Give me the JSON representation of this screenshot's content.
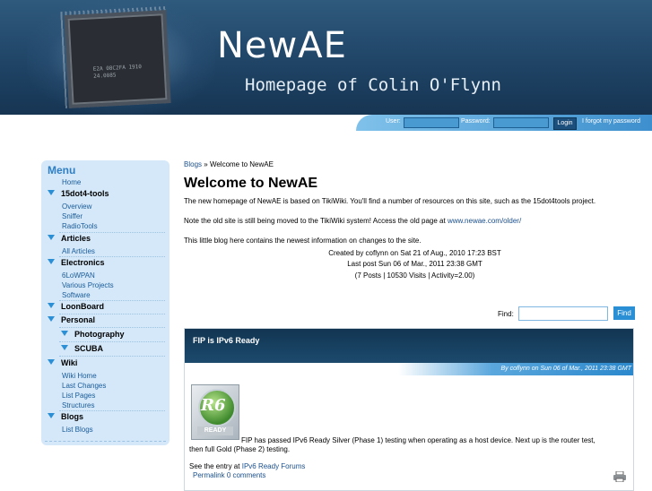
{
  "header": {
    "site_title": "NewAE",
    "site_subtitle": "Homepage of Colin O'Flynn",
    "chip_text": "E2A 08C2FA 1910 24.0085"
  },
  "login": {
    "user_label": "User:",
    "password_label": "Password:",
    "login_button": "Login",
    "forgot_link": "I forgot my password"
  },
  "sidebar": {
    "title": "Menu",
    "items": [
      {
        "label": "Home",
        "kind": "sub"
      },
      {
        "label": "15dot4-tools",
        "kind": "section"
      },
      {
        "label": "Overview",
        "kind": "sub"
      },
      {
        "label": "Sniffer",
        "kind": "sub"
      },
      {
        "label": "RadioTools",
        "kind": "sub"
      },
      {
        "label": "Articles",
        "kind": "section"
      },
      {
        "label": "All Articles",
        "kind": "sub"
      },
      {
        "label": "Electronics",
        "kind": "section"
      },
      {
        "label": "6LoWPAN",
        "kind": "sub"
      },
      {
        "label": "Various Projects",
        "kind": "sub"
      },
      {
        "label": "Software",
        "kind": "sub"
      },
      {
        "label": "LoonBoard",
        "kind": "section"
      },
      {
        "label": "Personal",
        "kind": "section"
      },
      {
        "label": "Photography",
        "kind": "section2"
      },
      {
        "label": "SCUBA",
        "kind": "section2"
      },
      {
        "label": "Wiki",
        "kind": "section"
      },
      {
        "label": "Wiki Home",
        "kind": "sub"
      },
      {
        "label": "Last Changes",
        "kind": "sub"
      },
      {
        "label": "List Pages",
        "kind": "sub"
      },
      {
        "label": "Structures",
        "kind": "sub"
      },
      {
        "label": "Blogs",
        "kind": "section"
      },
      {
        "label": "List Blogs",
        "kind": "sub"
      }
    ]
  },
  "main": {
    "breadcrumb_link": "Blogs",
    "breadcrumb_sep": "»",
    "breadcrumb_current": "Welcome to NewAE",
    "title": "Welcome to NewAE",
    "para1": "The new homepage of NewAE is based on TikiWiki. You'll find a number of resources on this site, such as the 15dot4tools project.",
    "para2_text": "Note the old site is still being moved to the TikiWiki system! Access the old page at",
    "para2_link": "www.newae.com/older/",
    "para3": "This little blog here contains the newest information on changes to the site.",
    "created_by": "Created by coflynn on Sat 21 of Aug., 2010 17:23 BST",
    "last_post": "Last post Sun 06 of Mar., 2011 23:38 GMT",
    "stats": "(7 Posts | 10530 Visits | Activity=2.00)",
    "find_label": "Find:",
    "find_button": "Find",
    "post": {
      "title": "FIP is IPv6 Ready",
      "meta": "By coflynn on Sun 06 of Mar., 2011 23:38 GMT",
      "logo_text": "R6",
      "logo_badge": "READY",
      "body": "FIP has passed IPv6 Ready Silver (Phase 1) testing when operating as a host device. Next up is the router test,",
      "body2": "then full Gold (Phase 2) testing.",
      "see_text": "See the entry at",
      "see_link": "IPv6 Ready Forums",
      "permalink": "Permalink",
      "comments": "0 comments"
    }
  }
}
